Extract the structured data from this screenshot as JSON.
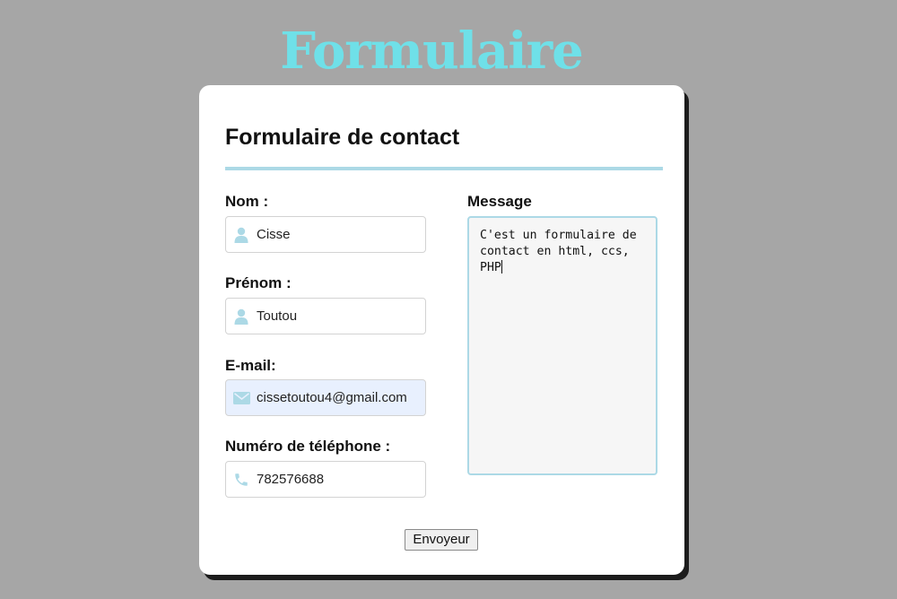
{
  "page": {
    "title": "Formulaire"
  },
  "form": {
    "title": "Formulaire de contact",
    "fields": [
      {
        "label": "Nom :",
        "value": "Cisse",
        "icon": "user-icon"
      },
      {
        "label": "Prénom :",
        "value": "Toutou",
        "icon": "user-icon"
      },
      {
        "label": "E-mail:",
        "value": "cissetoutou4@gmail.com",
        "icon": "envelope-icon"
      },
      {
        "label": "Numéro de téléphone :",
        "value": "782576688",
        "icon": "phone-icon"
      }
    ],
    "message": {
      "label": "Message",
      "value": "C'est un formulaire de contact en html, ccs, PHP"
    },
    "submit_label": "Envoyeur"
  },
  "colors": {
    "background": "#a6a6a6",
    "title": "#6fe0e8",
    "accent": "#acd9e6",
    "autofill": "#e8f0fe"
  }
}
